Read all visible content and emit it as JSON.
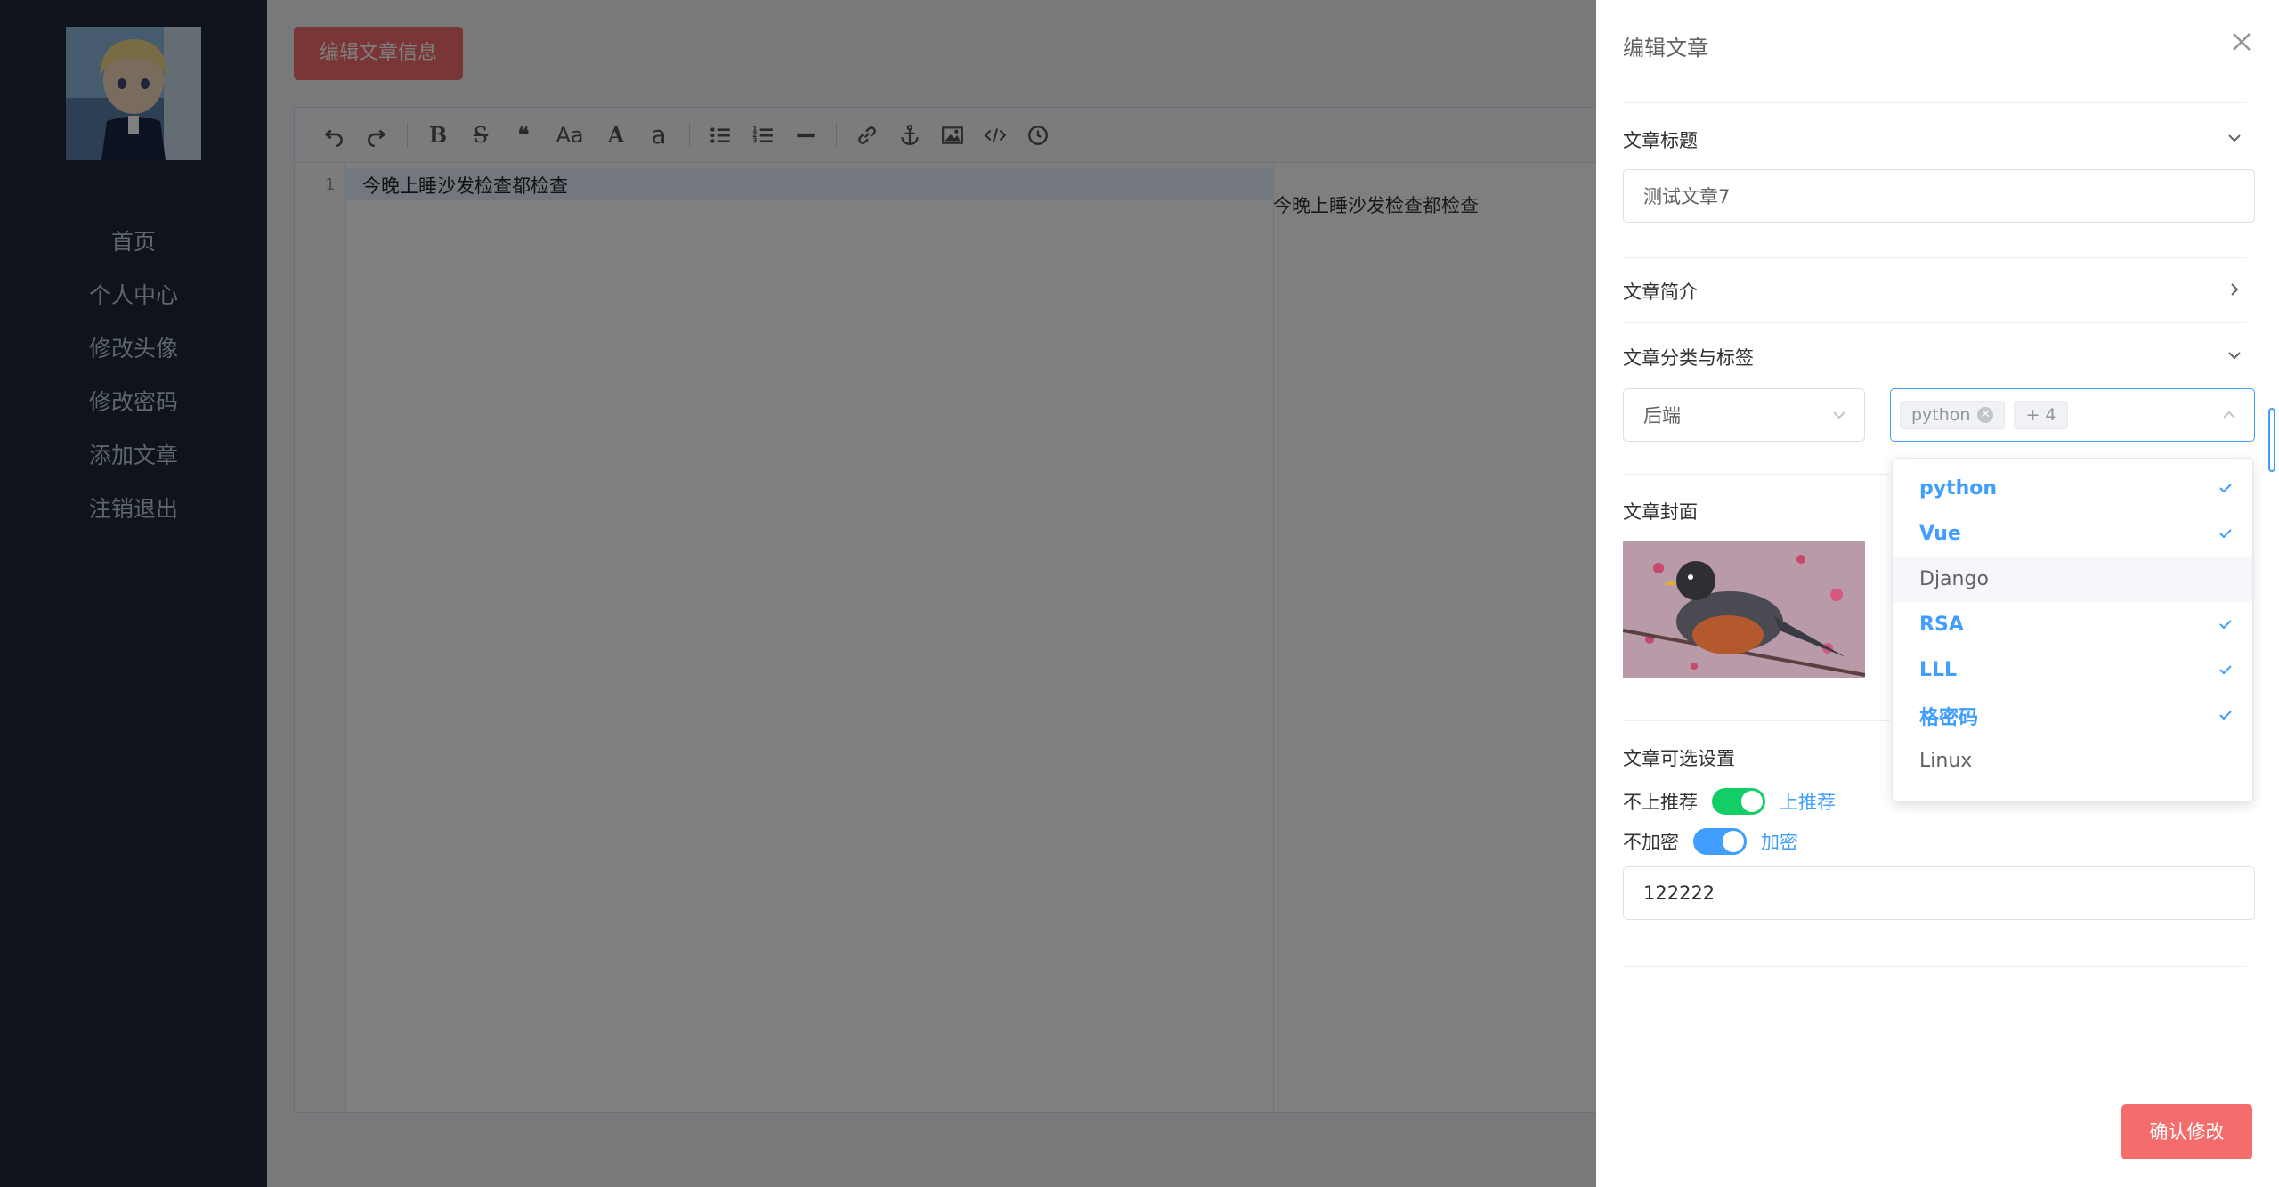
{
  "sidebar": {
    "items": [
      {
        "label": "首页"
      },
      {
        "label": "个人中心"
      },
      {
        "label": "修改头像"
      },
      {
        "label": "修改密码"
      },
      {
        "label": "添加文章"
      },
      {
        "label": "注销退出"
      }
    ]
  },
  "main": {
    "edit_info_button": "编辑文章信息",
    "editor": {
      "line_number": "1",
      "content": "今晚上睡沙发检查都检查",
      "preview": "今晚上睡沙发检查都检查"
    }
  },
  "drawer": {
    "title": "编辑文章",
    "title_section": {
      "label": "文章标题",
      "value": "测试文章7"
    },
    "summary_section": {
      "label": "文章简介"
    },
    "category_section": {
      "label": "文章分类与标签",
      "category_value": "后端",
      "tags": {
        "first_tag": "python",
        "more_count": "+ 4"
      }
    },
    "cover_section": {
      "label": "文章封面"
    },
    "options_section": {
      "label": "文章可选设置",
      "recommend": {
        "off_label": "不上推荐",
        "on_label": "上推荐",
        "state": "on"
      },
      "encrypt": {
        "off_label": "不加密",
        "on_label": "加密",
        "state": "on"
      },
      "password_value": "122222"
    },
    "confirm_button": "确认修改"
  },
  "tag_dropdown": {
    "options": [
      {
        "label": "python",
        "selected": true
      },
      {
        "label": "Vue",
        "selected": true
      },
      {
        "label": "Django",
        "selected": false
      },
      {
        "label": "RSA",
        "selected": true
      },
      {
        "label": "LLL",
        "selected": true
      },
      {
        "label": "格密码",
        "selected": true
      },
      {
        "label": "Linux",
        "selected": false
      }
    ]
  },
  "colors": {
    "sidebar_bg": "#1e2839",
    "primary": "#409eff",
    "danger": "#f56c6c",
    "success": "#13ce66"
  }
}
